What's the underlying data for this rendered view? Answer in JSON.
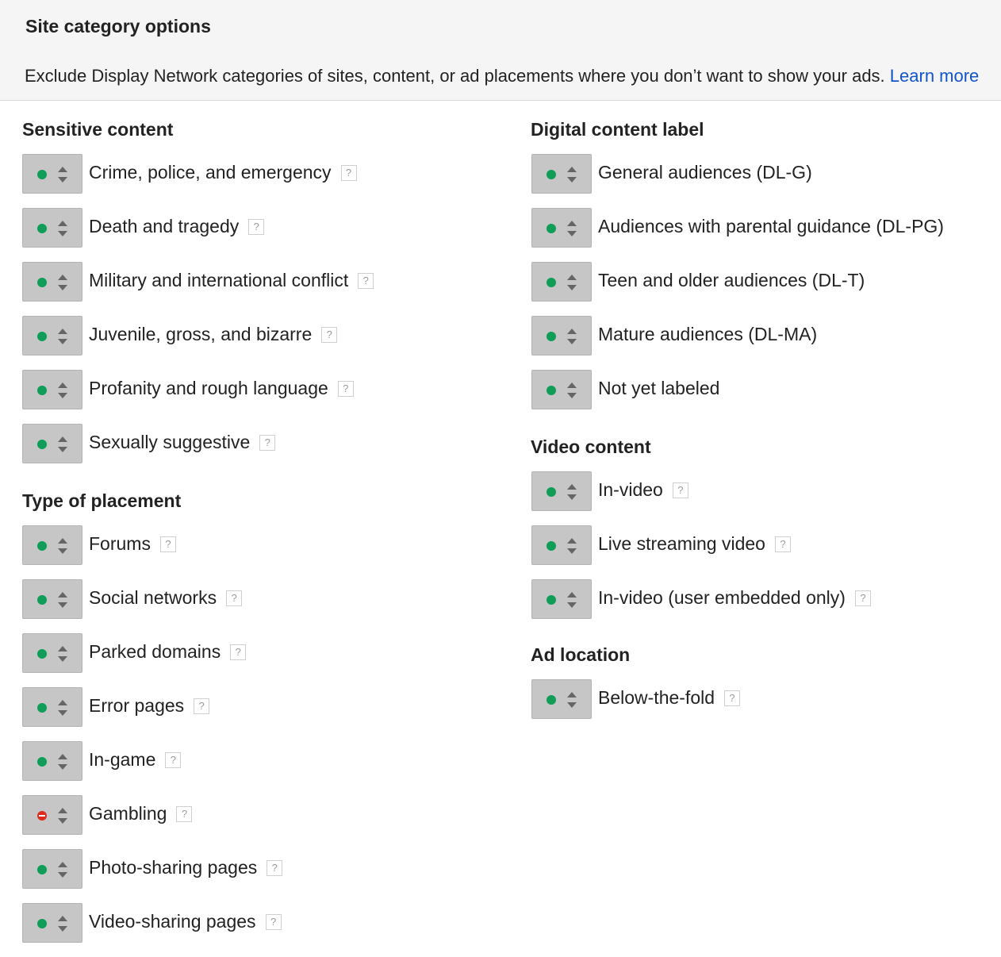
{
  "header": {
    "title": "Site category options",
    "description": "Exclude Display Network categories of sites, content, or ad placements where you don’t want to show your ads. ",
    "learn_more": "Learn more"
  },
  "colors": {
    "enabled": "#0f9d58",
    "excluded": "#dd2c1f",
    "link": "#1155cc"
  },
  "sections": {
    "sensitive": {
      "title": "Sensitive content",
      "items": [
        {
          "label": "Crime, police, and emergency",
          "state": "enabled",
          "help": "?"
        },
        {
          "label": "Death and tragedy",
          "state": "enabled",
          "help": "?"
        },
        {
          "label": "Military and international conflict",
          "state": "enabled",
          "help": "?"
        },
        {
          "label": "Juvenile, gross, and bizarre",
          "state": "enabled",
          "help": "?"
        },
        {
          "label": "Profanity and rough language",
          "state": "enabled",
          "help": "?"
        },
        {
          "label": "Sexually suggestive",
          "state": "enabled",
          "help": "?"
        }
      ]
    },
    "placement": {
      "title": "Type of placement",
      "items": [
        {
          "label": "Forums",
          "state": "enabled",
          "help": "?"
        },
        {
          "label": "Social networks",
          "state": "enabled",
          "help": "?"
        },
        {
          "label": "Parked domains",
          "state": "enabled",
          "help": "?"
        },
        {
          "label": "Error pages",
          "state": "enabled",
          "help": "?"
        },
        {
          "label": "In-game",
          "state": "enabled",
          "help": "?"
        },
        {
          "label": "Gambling",
          "state": "excluded",
          "help": "?"
        },
        {
          "label": "Photo-sharing pages",
          "state": "enabled",
          "help": "?"
        },
        {
          "label": "Video-sharing pages",
          "state": "enabled",
          "help": "?"
        }
      ]
    },
    "digital": {
      "title": "Digital content label",
      "items": [
        {
          "label": "General audiences (DL-G)",
          "state": "enabled"
        },
        {
          "label": "Audiences with parental guidance (DL-PG)",
          "state": "enabled"
        },
        {
          "label": "Teen and older audiences (DL-T)",
          "state": "enabled"
        },
        {
          "label": "Mature audiences (DL-MA)",
          "state": "enabled"
        },
        {
          "label": "Not yet labeled",
          "state": "enabled"
        }
      ]
    },
    "video": {
      "title": "Video content",
      "items": [
        {
          "label": "In-video",
          "state": "enabled",
          "help": "?"
        },
        {
          "label": "Live streaming video",
          "state": "enabled",
          "help": "?"
        },
        {
          "label": "In-video (user embedded only)",
          "state": "enabled",
          "help": "?"
        }
      ]
    },
    "adloc": {
      "title": "Ad location",
      "items": [
        {
          "label": "Below-the-fold",
          "state": "enabled",
          "help": "?"
        }
      ]
    }
  }
}
